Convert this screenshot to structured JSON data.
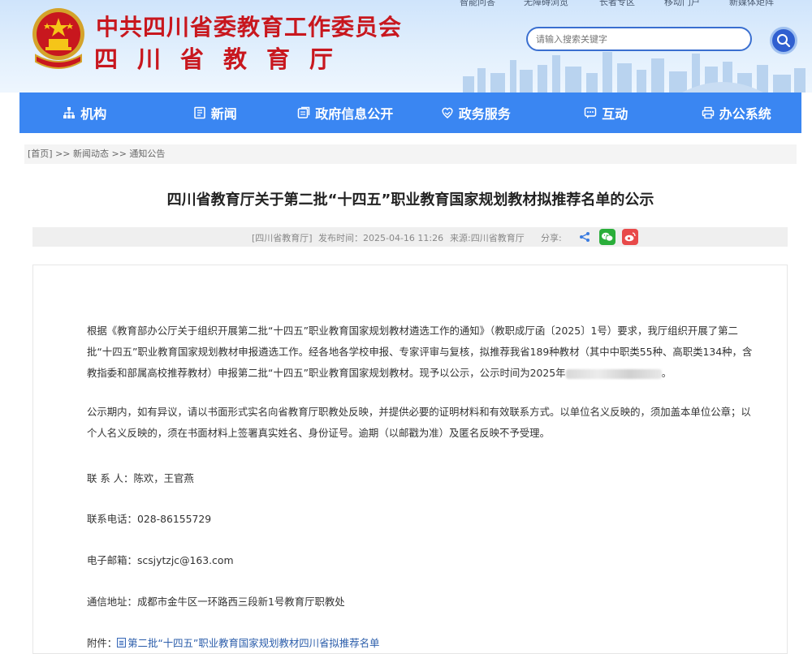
{
  "header": {
    "top_links": [
      "智能问答",
      "无障碍浏览",
      "长者专区",
      "移动门户",
      "新媒体矩阵"
    ],
    "org_title": "中共四川省委教育工作委员会",
    "org_subtitle": "四川省教育厅",
    "search": {
      "placeholder": "请输入搜索关键字"
    }
  },
  "nav": {
    "items": [
      {
        "label": "机构",
        "icon": "org-chart-icon"
      },
      {
        "label": "新闻",
        "icon": "news-icon"
      },
      {
        "label": "政府信息公开",
        "icon": "gov-info-icon"
      },
      {
        "label": "政务服务",
        "icon": "service-icon"
      },
      {
        "label": "互动",
        "icon": "chat-icon"
      },
      {
        "label": "办公系统",
        "icon": "printer-icon"
      }
    ]
  },
  "breadcrumb": "[首页] >> 新闻动态 >> 通知公告",
  "article": {
    "title": "四川省教育厅关于第二批“十四五”职业教育国家规划教材拟推荐名单的公示",
    "meta_source_tag": "[四川省教育厅]",
    "meta_time": "发布时间：2025-04-16 11:26",
    "meta_origin": "来源:四川省教育厅",
    "meta_share": "分享:",
    "para1": "根据《教育部办公厅关于组织开展第二批“十四五”职业教育国家规划教材遴选工作的通知》（教职成厅函〔2025〕1号）要求，我厅组织开展了第二批“十四五”职业教育国家规划教材申报遴选工作。经各地各学校申报、专家评审与复核，拟推荐我省189种教材（其中中职类55种、高职类134种，含教指委和部属高校推荐教材）申报第二批“十四五”职业教育国家规划教材。现予以公示，公示时间为2025年",
    "para1_end": "。",
    "para2": "公示期内，如有异议，请以书面形式实名向省教育厅职教处反映，并提供必要的证明材料和有效联系方式。以单位名义反映的，须加盖本单位公章；以个人名义反映的，须在书面材料上签署真实姓名、身份证号。逾期（以邮戳为准）及匿名反映不予受理。",
    "contact_people": "联 系 人：陈欢，王官燕",
    "contact_phone": "联系电话：028-86155729",
    "contact_email": "电子邮箱：scsjytzjc@163.com",
    "contact_address": "通信地址：成都市金牛区一环路西三段新1号教育厅职教处",
    "attachment_label": "附件：",
    "attachment_link": "第二批“十四五”职业教育国家规划教材四川省拟推荐名单"
  },
  "colors": {
    "brand_red": "#c8171e",
    "nav_blue": "#3a86f2",
    "link_blue": "#2a5caa",
    "wechat_green": "#2aae3a",
    "weibo_red": "#e84a4a",
    "share_blue": "#3a7be0"
  }
}
